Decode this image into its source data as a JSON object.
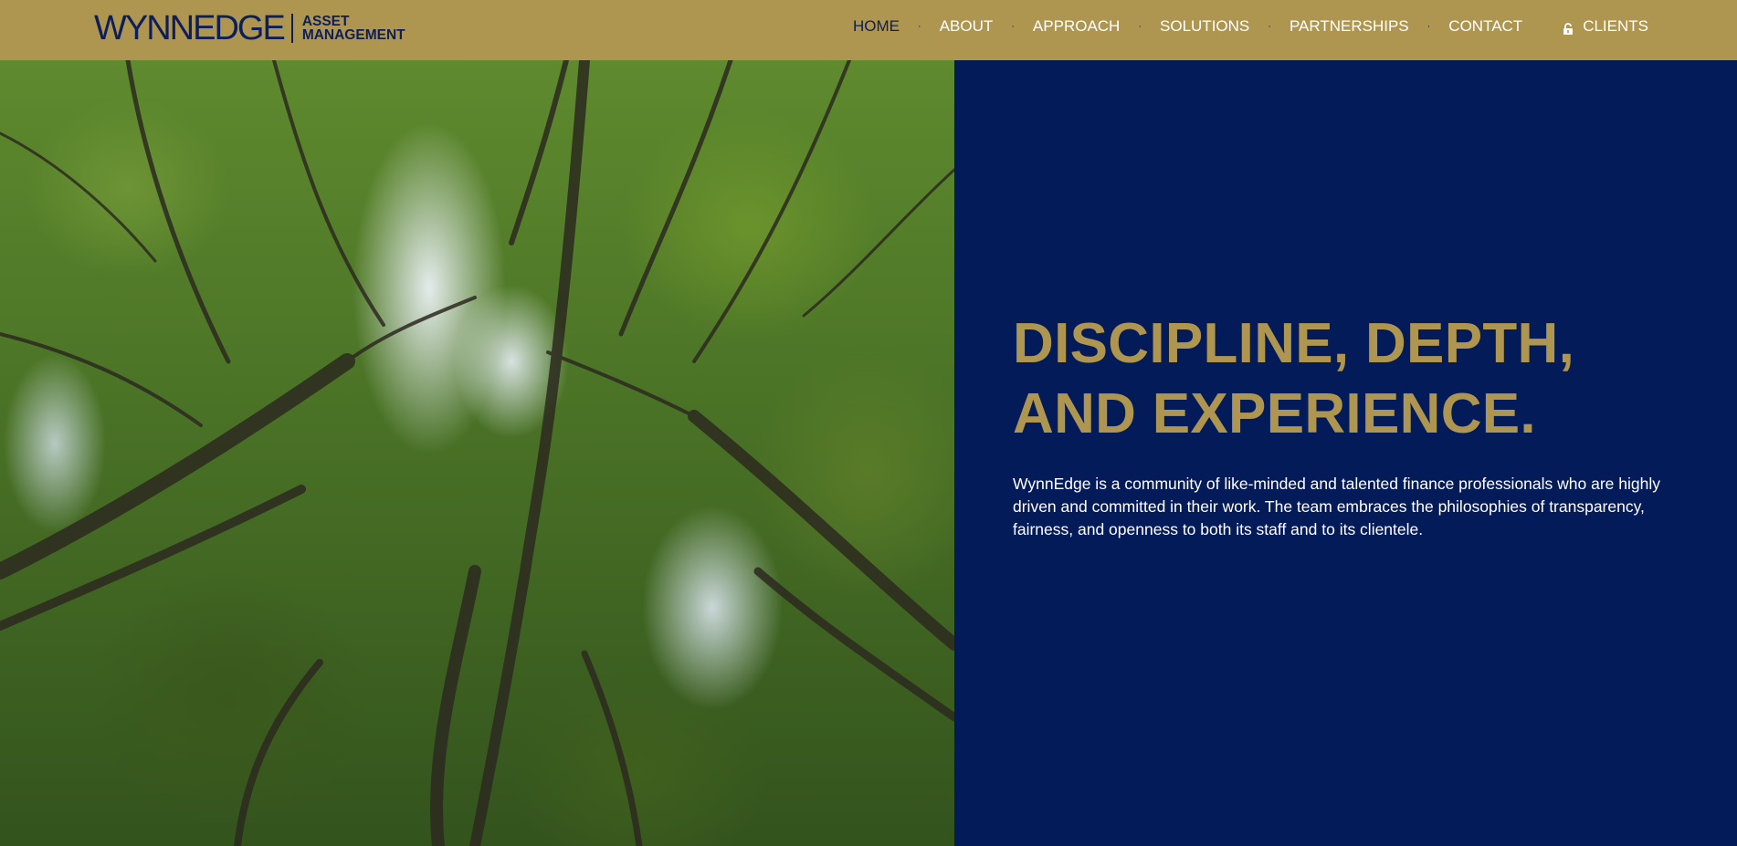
{
  "brand": {
    "wordmark_light": "WYNN",
    "wordmark_heavy": "EDGE",
    "sub_line1": "ASSET",
    "sub_line2": "MANAGEMENT",
    "color_gold": "#ae9650",
    "color_navy": "#041b5a"
  },
  "nav": {
    "items": [
      {
        "label": "HOME",
        "active": true
      },
      {
        "label": "ABOUT",
        "active": false
      },
      {
        "label": "APPROACH",
        "active": false
      },
      {
        "label": "SOLUTIONS",
        "active": false
      },
      {
        "label": "PARTNERSHIPS",
        "active": false
      },
      {
        "label": "CONTACT",
        "active": false
      }
    ],
    "separator": "·",
    "clients_label": "CLIENTS",
    "clients_icon": "lock-icon"
  },
  "hero": {
    "heading_line1": "DISCIPLINE, DEPTH,",
    "heading_line2": "AND EXPERIENCE.",
    "body": "WynnEdge is a community of like-minded and talented finance professionals who are highly driven and committed in their work. The team embraces the philosophies of transparency, fairness, and openness to both its staff and to its clientele.",
    "image_subject": "forest canopy viewed from below",
    "prev_icon": "chevron-left-icon",
    "next_icon": "chevron-right-icon"
  }
}
